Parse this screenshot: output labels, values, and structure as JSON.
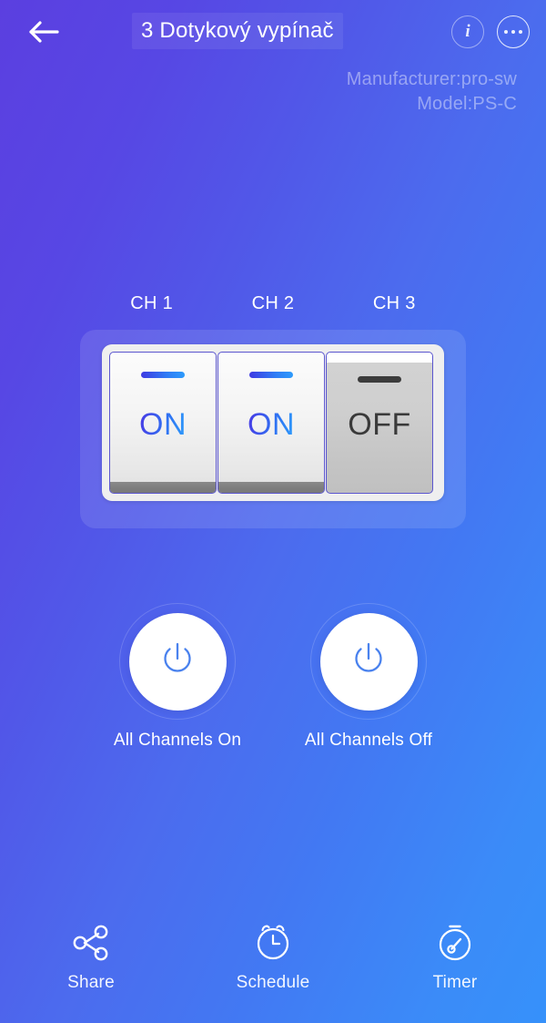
{
  "header": {
    "back_icon": "back-arrow-icon",
    "title": "3 Dotykový vypínač",
    "info_icon": "info-icon",
    "info_glyph": "i",
    "more_icon": "more-options-icon"
  },
  "device_meta": {
    "manufacturer": "Manufacturer:pro-sw",
    "model": "Model:PS-C"
  },
  "channels": {
    "labels": [
      "CH 1",
      "CH 2",
      "CH 3"
    ],
    "switches": [
      {
        "name": "channel-1-switch",
        "state": "ON",
        "indicator": "blue"
      },
      {
        "name": "channel-2-switch",
        "state": "ON",
        "indicator": "blue"
      },
      {
        "name": "channel-3-switch",
        "state": "OFF",
        "indicator": "dark"
      }
    ]
  },
  "all_channels": [
    {
      "name": "all-channels-on-button",
      "label": "All Channels On",
      "icon": "power-icon"
    },
    {
      "name": "all-channels-off-button",
      "label": "All Channels Off",
      "icon": "power-icon"
    }
  ],
  "bottom_nav": [
    {
      "name": "nav-share",
      "label": "Share",
      "icon": "share-icon"
    },
    {
      "name": "nav-schedule",
      "label": "Schedule",
      "icon": "alarm-clock-icon"
    },
    {
      "name": "nav-timer",
      "label": "Timer",
      "icon": "stopwatch-icon"
    }
  ],
  "colors": {
    "bg_start": "#5B3FE0",
    "bg_end": "#3691FA",
    "accent_blue": "#2F7DF5",
    "switch_border": "#5B56CF",
    "off_gray": "#C4C4C4",
    "text_white": "#FFFFFF",
    "meta_text": "rgba(255,255,255,0.42)"
  }
}
